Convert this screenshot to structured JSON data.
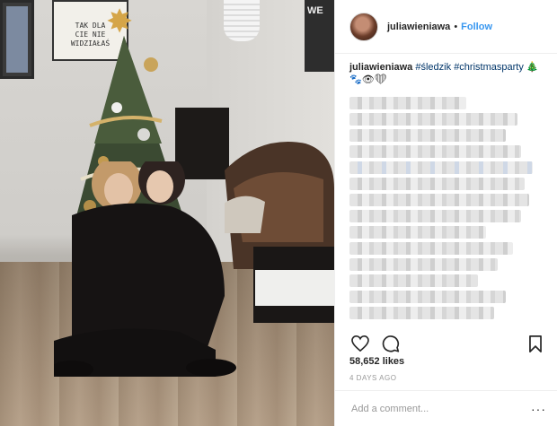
{
  "photo": {
    "poster_text": "TAK DLA\nCIE NIE\nWIDZIAŁAŚ",
    "sign_text": "WE"
  },
  "header": {
    "username": "juliawieniawa",
    "separator": "•",
    "follow_label": "Follow"
  },
  "caption": {
    "username": "juliawieniawa",
    "hashtag1": "#śledzik",
    "hashtag2": "#christmasparty",
    "emoji_line1": "🎄",
    "emoji_line2": "🐾👁❤"
  },
  "actions": {
    "likes": "58,652 likes",
    "time": "4 DAYS AGO"
  },
  "add_comment": {
    "placeholder": "Add a comment...",
    "more_label": "···"
  },
  "icons": {
    "like": "heart-icon",
    "comment": "comment-icon",
    "save": "bookmark-icon"
  },
  "colors": {
    "link_blue": "#3897f0",
    "hashtag": "#003569",
    "text": "#262626",
    "muted": "#999999",
    "border": "#efefef"
  }
}
